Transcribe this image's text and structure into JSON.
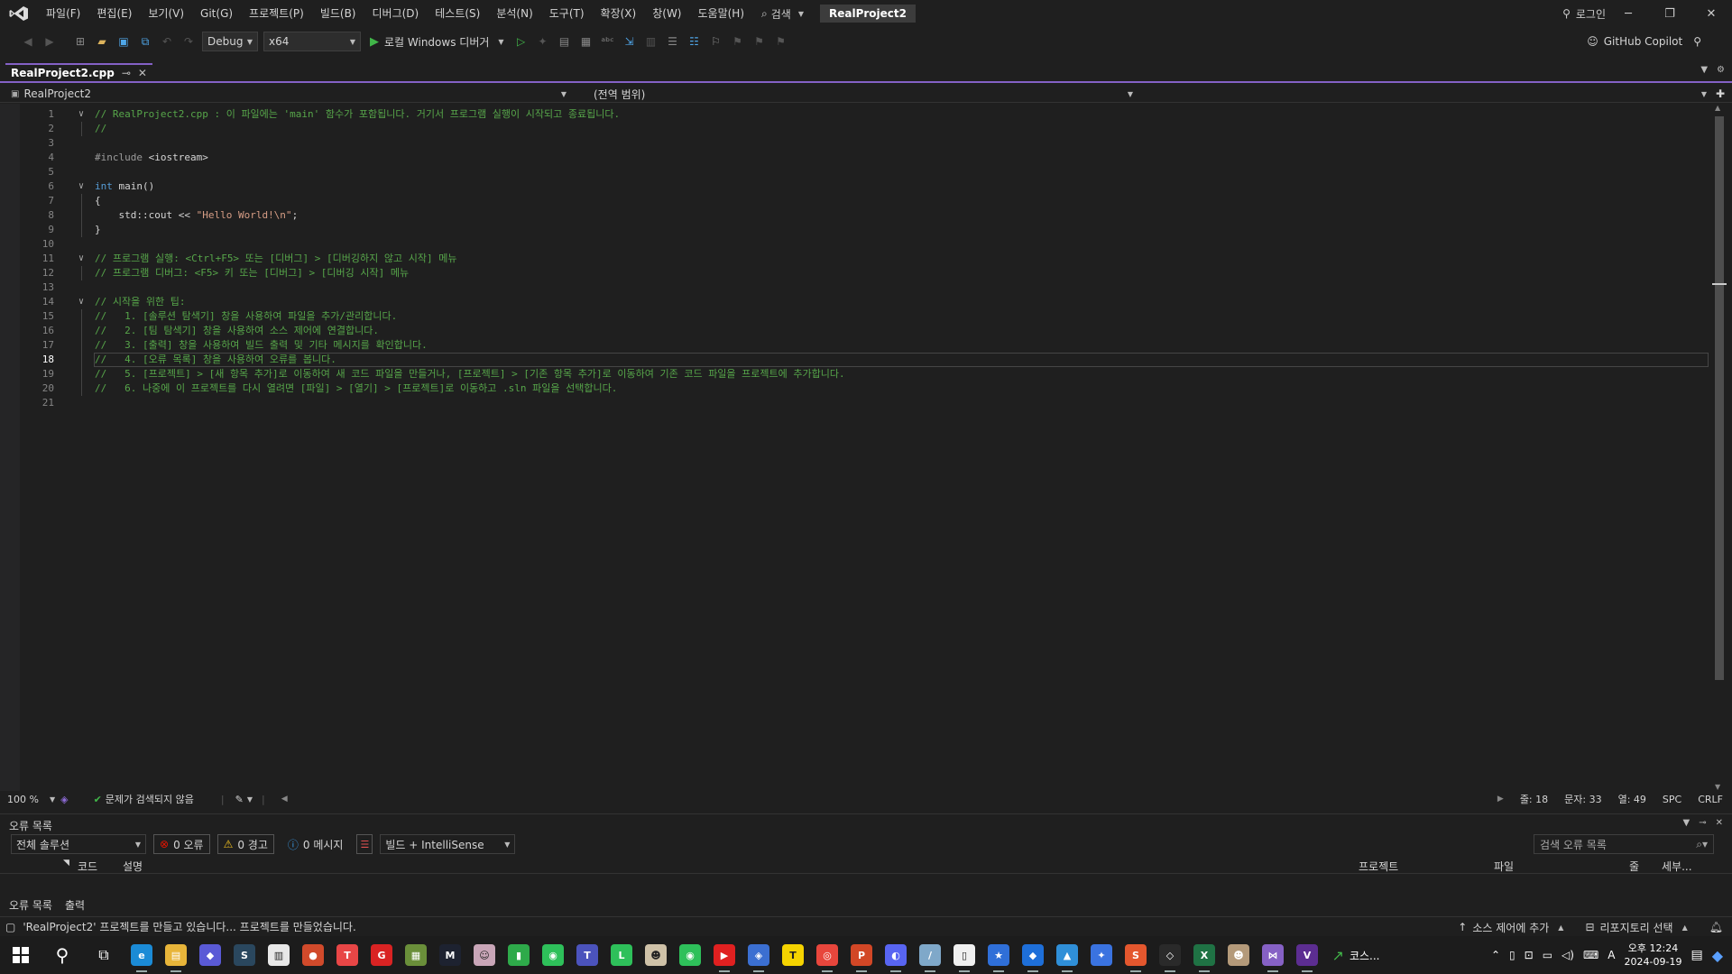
{
  "menu": {
    "items": [
      "파일(F)",
      "편집(E)",
      "보기(V)",
      "Git(G)",
      "프로젝트(P)",
      "빌드(B)",
      "디버그(D)",
      "테스트(S)",
      "분석(N)",
      "도구(T)",
      "확장(X)",
      "창(W)",
      "도움말(H)"
    ],
    "search_label": "검색",
    "solution_name": "RealProject2",
    "login_label": "로그인"
  },
  "toolbar": {
    "config": "Debug",
    "platform": "x64",
    "run_label": "로컬 Windows 디버거",
    "copilot_label": "GitHub Copilot"
  },
  "tab": {
    "filename": "RealProject2.cpp",
    "pin_glyph": "⊸",
    "close_glyph": "✕"
  },
  "navbar": {
    "project": "RealProject2",
    "scope": "(전역 범위)"
  },
  "editor": {
    "current_line": 18,
    "lines": [
      {
        "n": "1",
        "fold": "∨",
        "html_parts": [
          {
            "cls": "cmt",
            "t": "// RealProject2.cpp : 이 파일에는 'main' 함수가 포함됩니다. 거기서 프로그램 실행이 시작되고 종료됩니다."
          }
        ]
      },
      {
        "n": "2",
        "fold": "",
        "html_parts": [
          {
            "cls": "cmt",
            "t": "//"
          }
        ]
      },
      {
        "n": "3",
        "fold": "",
        "html_parts": []
      },
      {
        "n": "4",
        "fold": "",
        "html_parts": [
          {
            "cls": "pp",
            "t": "#include "
          },
          {
            "cls": "",
            "t": "<iostream>"
          }
        ]
      },
      {
        "n": "5",
        "fold": "",
        "html_parts": []
      },
      {
        "n": "6",
        "fold": "∨",
        "html_parts": [
          {
            "cls": "kw",
            "t": "int"
          },
          {
            "cls": "",
            "t": " main()"
          }
        ]
      },
      {
        "n": "7",
        "fold": "",
        "html_parts": [
          {
            "cls": "",
            "t": "{"
          }
        ]
      },
      {
        "n": "8",
        "fold": "",
        "html_parts": [
          {
            "cls": "",
            "t": "    std::cout << "
          },
          {
            "cls": "str",
            "t": "\"Hello World!\\n\""
          },
          {
            "cls": "",
            "t": ";"
          }
        ]
      },
      {
        "n": "9",
        "fold": "",
        "html_parts": [
          {
            "cls": "",
            "t": "}"
          }
        ]
      },
      {
        "n": "10",
        "fold": "",
        "html_parts": []
      },
      {
        "n": "11",
        "fold": "∨",
        "html_parts": [
          {
            "cls": "cmt",
            "t": "// 프로그램 실행: <Ctrl+F5> 또는 [디버그] > [디버깅하지 않고 시작] 메뉴"
          }
        ]
      },
      {
        "n": "12",
        "fold": "",
        "html_parts": [
          {
            "cls": "cmt",
            "t": "// 프로그램 디버그: <F5> 키 또는 [디버그] > [디버깅 시작] 메뉴"
          }
        ]
      },
      {
        "n": "13",
        "fold": "",
        "html_parts": []
      },
      {
        "n": "14",
        "fold": "∨",
        "html_parts": [
          {
            "cls": "cmt",
            "t": "// 시작을 위한 팁:"
          }
        ]
      },
      {
        "n": "15",
        "fold": "",
        "html_parts": [
          {
            "cls": "cmt",
            "t": "//   1. [솔루션 탐색기] 창을 사용하여 파일을 추가/관리합니다."
          }
        ]
      },
      {
        "n": "16",
        "fold": "",
        "html_parts": [
          {
            "cls": "cmt",
            "t": "//   2. [팀 탐색기] 창을 사용하여 소스 제어에 연결합니다."
          }
        ]
      },
      {
        "n": "17",
        "fold": "",
        "html_parts": [
          {
            "cls": "cmt",
            "t": "//   3. [출력] 창을 사용하여 빌드 출력 및 기타 메시지를 확인합니다."
          }
        ]
      },
      {
        "n": "18",
        "fold": "",
        "html_parts": [
          {
            "cls": "cmt",
            "t": "//   4. [오류 목록] 창을 사용하여 오류를 봅니다."
          }
        ]
      },
      {
        "n": "19",
        "fold": "",
        "html_parts": [
          {
            "cls": "cmt",
            "t": "//   5. [프로젝트] > [새 항목 추가]로 이동하여 새 코드 파일을 만들거나, [프로젝트] > [기존 항목 추가]로 이동하여 기존 코드 파일을 프로젝트에 추가합니다."
          }
        ]
      },
      {
        "n": "20",
        "fold": "",
        "html_parts": [
          {
            "cls": "cmt",
            "t": "//   6. 나중에 이 프로젝트를 다시 열려면 [파일] > [열기] > [프로젝트]로 이동하고 .sln 파일을 선택합니다."
          }
        ]
      },
      {
        "n": "21",
        "fold": "",
        "html_parts": []
      }
    ]
  },
  "edstatus": {
    "zoom": "100 %",
    "issues": "문제가 검색되지 않음",
    "line": "줄: 18",
    "char": "문자: 33",
    "col": "열: 49",
    "spc": "SPC",
    "crlf": "CRLF"
  },
  "errlist": {
    "title": "오류 목록",
    "scope": "전체 솔루션",
    "errors": "0 오류",
    "warnings": "0 경고",
    "messages": "0 메시지",
    "build_filter": "빌드 + IntelliSense",
    "search_placeholder": "검색 오류 목록",
    "col_code": "코드",
    "col_desc": "설명",
    "col_project": "프로젝트",
    "col_file": "파일",
    "col_line": "줄",
    "col_detail": "세부...",
    "tab_errors": "오류 목록",
    "tab_output": "출력"
  },
  "statusbar": {
    "message": "'RealProject2' 프로젝트를 만들고 있습니다... 프로젝트를 만들었습니다.",
    "source_control": "소스 제어에 추가",
    "repo": "리포지토리 선택"
  },
  "taskbar": {
    "apps": [
      {
        "name": "edge-icon",
        "color": "#1b8bd6",
        "label": "e"
      },
      {
        "name": "file-explorer-icon",
        "color": "#e8b53a",
        "label": "▤"
      },
      {
        "name": "copilot-app-icon",
        "color": "#5a5ad6",
        "label": "◆"
      },
      {
        "name": "steam-icon",
        "color": "#2a475e",
        "label": "S"
      },
      {
        "name": "notepad-icon",
        "color": "#e8e8e8",
        "label": "▥"
      },
      {
        "name": "app-red-icon",
        "color": "#d14a2b",
        "label": "●"
      },
      {
        "name": "app-pink-icon",
        "color": "#e84646",
        "label": "T"
      },
      {
        "name": "app-g-icon",
        "color": "#d92323",
        "label": "G"
      },
      {
        "name": "minecraft-icon",
        "color": "#6a8f3a",
        "label": "▦"
      },
      {
        "name": "app-m-icon",
        "color": "#1d2230",
        "label": "M"
      },
      {
        "name": "game-avatar-icon",
        "color": "#c9a6b8",
        "label": "☺"
      },
      {
        "name": "app-green-doc-icon",
        "color": "#2eaa4a",
        "label": "▮"
      },
      {
        "name": "line-game-icon",
        "color": "#2ec05a",
        "label": "◉"
      },
      {
        "name": "teams-icon",
        "color": "#4b53bc",
        "label": "T"
      },
      {
        "name": "line-icon",
        "color": "#2ec05a",
        "label": "L"
      },
      {
        "name": "game-character-icon",
        "color": "#cfc2a8",
        "label": "☻"
      },
      {
        "name": "line-games-icon",
        "color": "#2ec05a",
        "label": "◉"
      },
      {
        "name": "youtube-icon",
        "color": "#e02020",
        "label": "▶"
      },
      {
        "name": "roblox-studio-icon",
        "color": "#3b6fd1",
        "label": "◈"
      },
      {
        "name": "kakaotalk-icon",
        "color": "#f5d300",
        "label": "T"
      },
      {
        "name": "chrome-icon",
        "color": "#e8463c",
        "label": "◎"
      },
      {
        "name": "powerpoint-icon",
        "color": "#d24726",
        "label": "P"
      },
      {
        "name": "discord-icon",
        "color": "#5865f2",
        "label": "◐"
      },
      {
        "name": "app-blade-icon",
        "color": "#7fa8c9",
        "label": "/"
      },
      {
        "name": "notepad-white-icon",
        "color": "#f0f0f0",
        "label": "▯"
      },
      {
        "name": "app-star-icon",
        "color": "#2f6fd8",
        "label": "★"
      },
      {
        "name": "maps-icon",
        "color": "#1e6fd9",
        "label": "◆"
      },
      {
        "name": "photos-icon",
        "color": "#2f8fd8",
        "label": "▲"
      },
      {
        "name": "app-puzzle-icon",
        "color": "#3a73e0",
        "label": "✦"
      },
      {
        "name": "app-s-icon",
        "color": "#e4572e",
        "label": "S"
      },
      {
        "name": "unity-icon",
        "color": "#2a2a2a",
        "label": "◇"
      },
      {
        "name": "excel-icon",
        "color": "#1f7244",
        "label": "X"
      },
      {
        "name": "game-portrait-icon",
        "color": "#b49a7a",
        "label": "☻"
      },
      {
        "name": "visual-studio-icon",
        "color": "#8661c5",
        "label": "⋈"
      },
      {
        "name": "visual-studio-preview-icon",
        "color": "#5c2d91",
        "label": "V"
      }
    ],
    "stock_label": "코스...",
    "ime": "A",
    "time": "오후 12:24",
    "date": "2024-09-19"
  }
}
